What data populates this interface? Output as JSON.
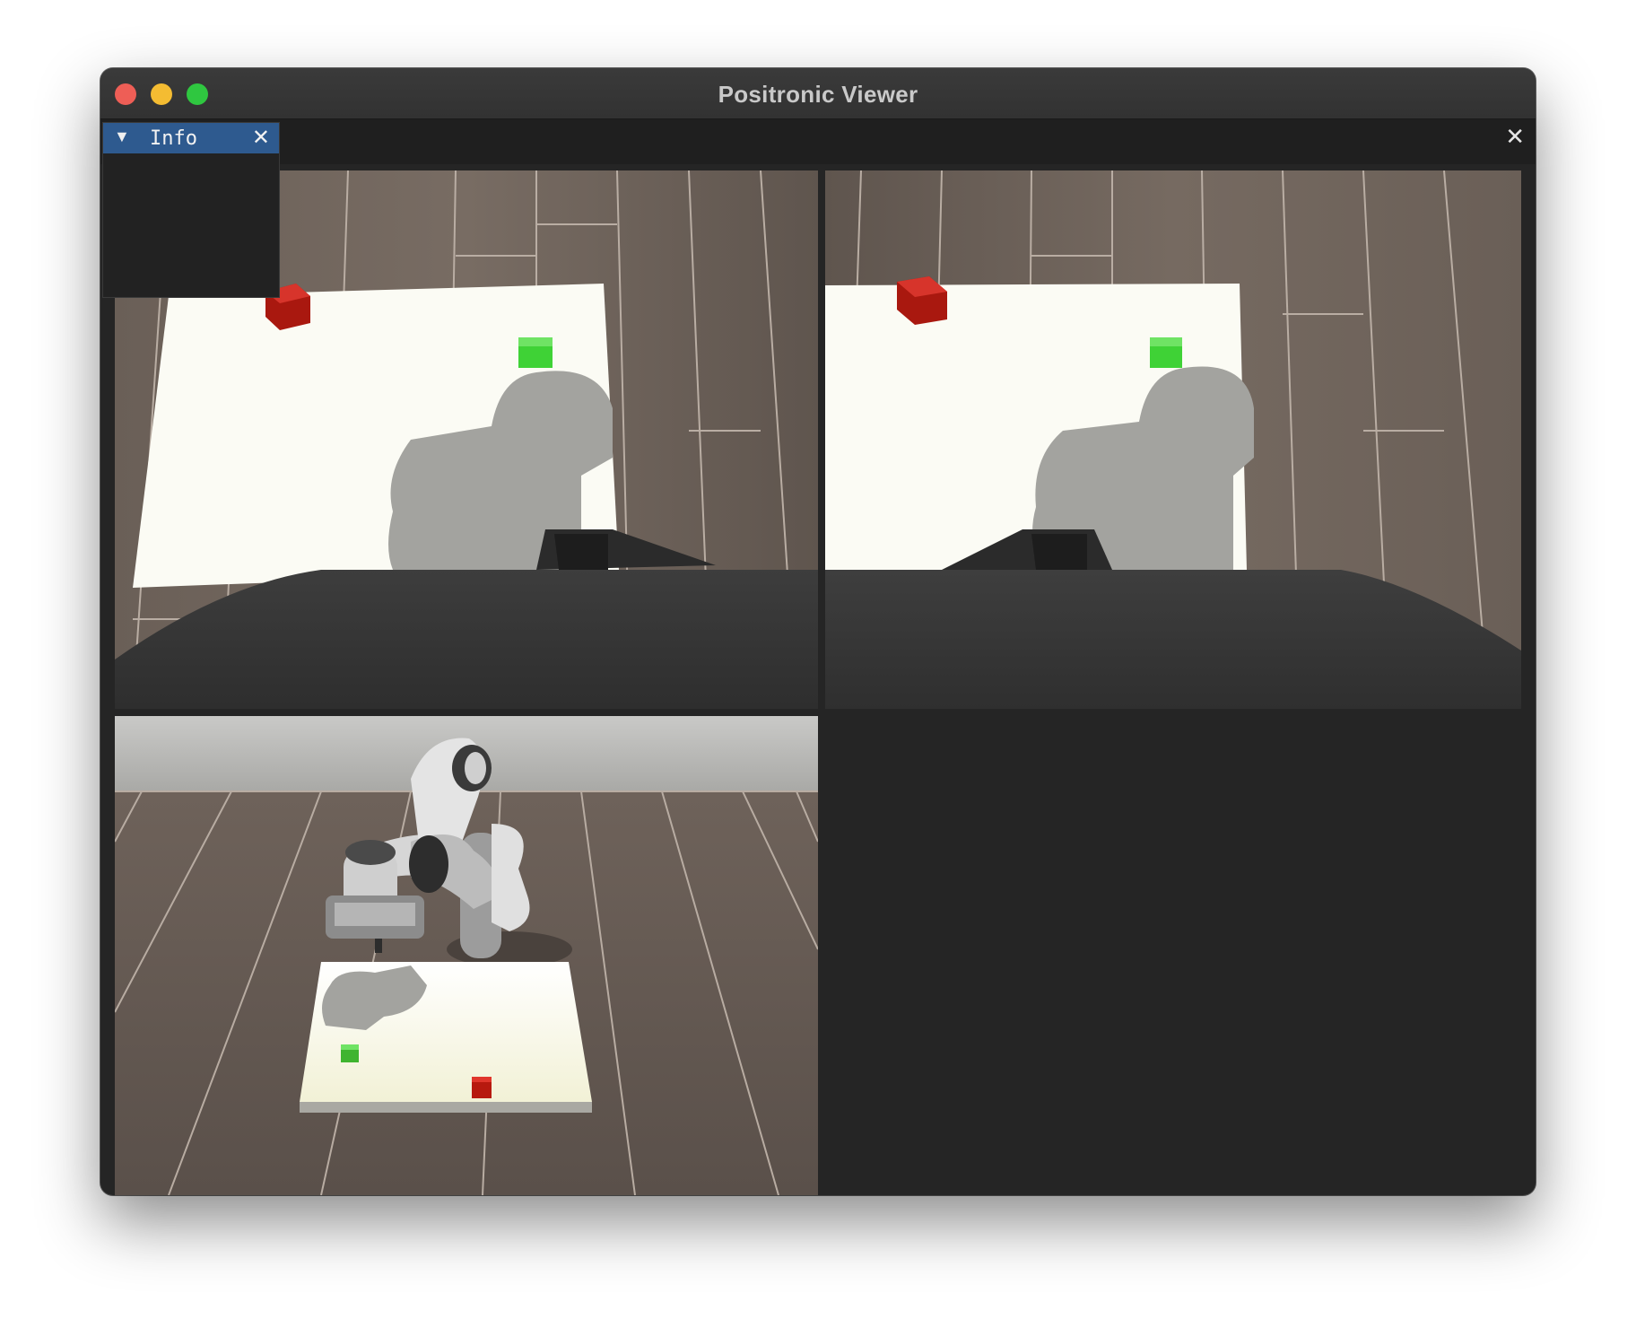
{
  "window": {
    "title": "Positronic Viewer"
  },
  "toolbar": {
    "close_glyph": "✕"
  },
  "info_panel": {
    "collapse_glyph": "▼",
    "title": "Info",
    "close_glyph": "✕"
  },
  "viewports": [
    {
      "view": "camera-left",
      "content": "table top with red cube and green cube, gripper in foreground"
    },
    {
      "view": "camera-right",
      "content": "table top with red cube and green cube, gripper in foreground"
    },
    {
      "view": "scene-overview",
      "content": "robot arm above table with green cube and red cube"
    },
    {
      "view": "empty"
    }
  ],
  "colors": {
    "titlebar": "#353535",
    "info_header": "#2e5a8f",
    "cube_red": "#c9231c",
    "cube_green": "#3fd236",
    "table": "#fbfbf4",
    "floor": "#6d625a",
    "background": "#252525"
  }
}
